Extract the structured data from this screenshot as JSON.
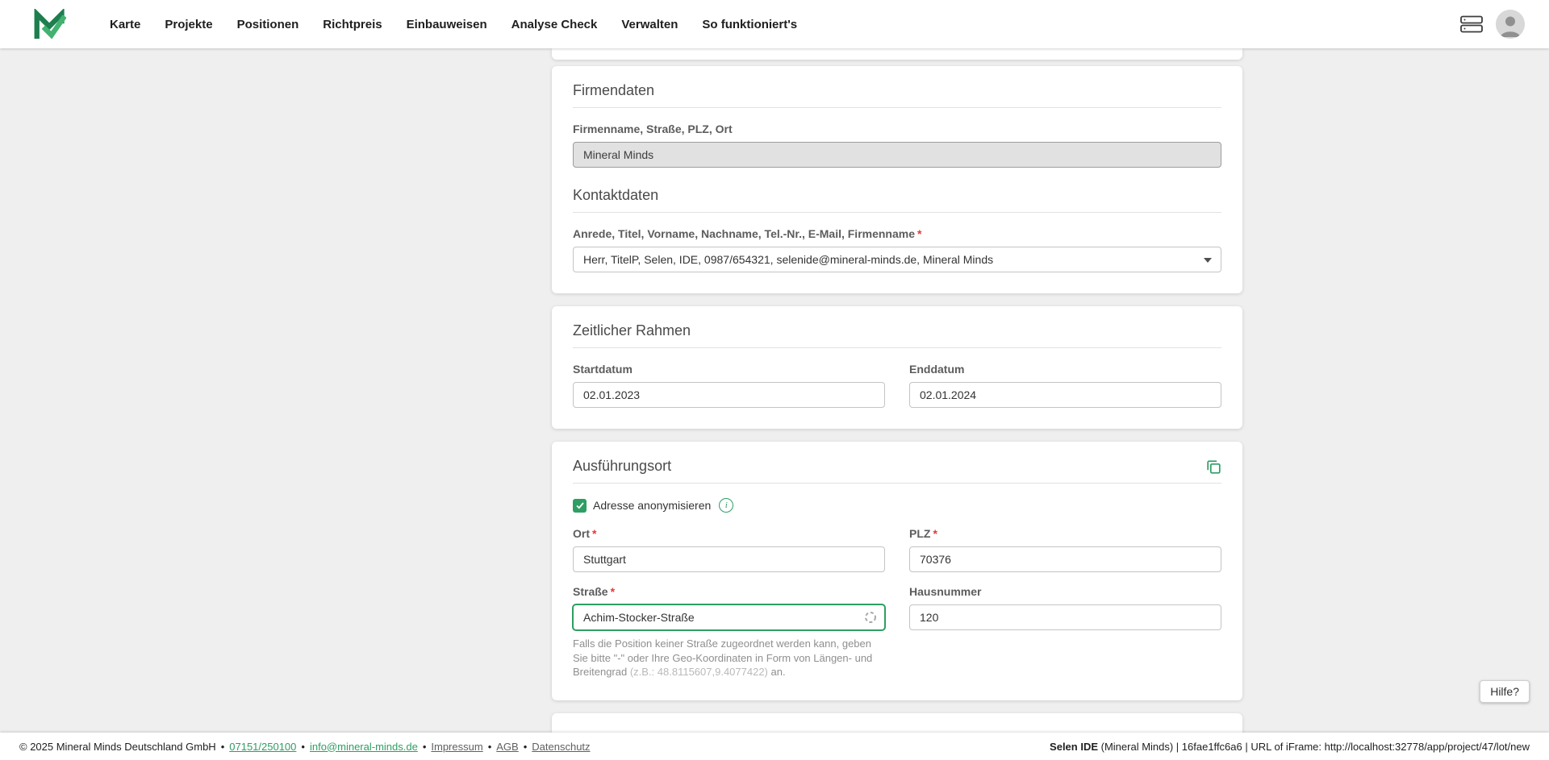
{
  "nav": {
    "items": [
      "Karte",
      "Projekte",
      "Positionen",
      "Richtpreis",
      "Einbauweisen",
      "Analyse Check",
      "Verwalten",
      "So funktioniert's"
    ]
  },
  "required_marker": "*",
  "cards": {
    "firmendaten": {
      "title": "Firmendaten",
      "address_label": "Firmenname, Straße, PLZ, Ort",
      "address_value": "Mineral Minds",
      "kontakt_title": "Kontaktdaten",
      "kontakt_label": "Anrede, Titel, Vorname, Nachname, Tel.-Nr., E-Mail, Firmenname",
      "kontakt_value": "Herr, TitelP, Selen, IDE, 0987/654321, selenide@mineral-minds.de, Mineral Minds"
    },
    "zeitlicher_rahmen": {
      "title": "Zeitlicher Rahmen",
      "startdatum_label": "Startdatum",
      "startdatum_value": "02.01.2023",
      "enddatum_label": "Enddatum",
      "enddatum_value": "02.01.2024"
    },
    "ausfuehrungsort": {
      "title": "Ausführungsort",
      "anonymize_label": "Adresse anonymisieren",
      "ort_label": "Ort",
      "ort_value": "Stuttgart",
      "plz_label": "PLZ",
      "plz_value": "70376",
      "strasse_label": "Straße",
      "strasse_value": "Achim-Stocker-Straße",
      "hausnummer_label": "Hausnummer",
      "hausnummer_value": "120",
      "hint_text": "Falls die Position keiner Straße zugeordnet werden kann, geben Sie bitte \"-\" oder Ihre Geo-Koordinaten in Form von Längen- und Breitengrad ",
      "hint_example": "(z.B.: 48.8115607,9.4077422)",
      "hint_suffix": " an."
    }
  },
  "help_button_label": "Hilfe?",
  "footer": {
    "copyright": "© 2025 Mineral Minds Deutschland GmbH",
    "separator": "•",
    "phone": "07151/250100",
    "email": "info@mineral-minds.de",
    "impressum": "Impressum",
    "agb": "AGB",
    "datenschutz": "Datenschutz",
    "app_name": "Selen IDE",
    "app_info": " (Mineral Minds) | 16fae1ffc6a6 | URL of iFrame: http://localhost:32778/app/project/47/lot/new"
  },
  "icons": {
    "info": "i"
  },
  "colors": {
    "accent_green": "#2e9e63",
    "required_red": "#e53935"
  }
}
